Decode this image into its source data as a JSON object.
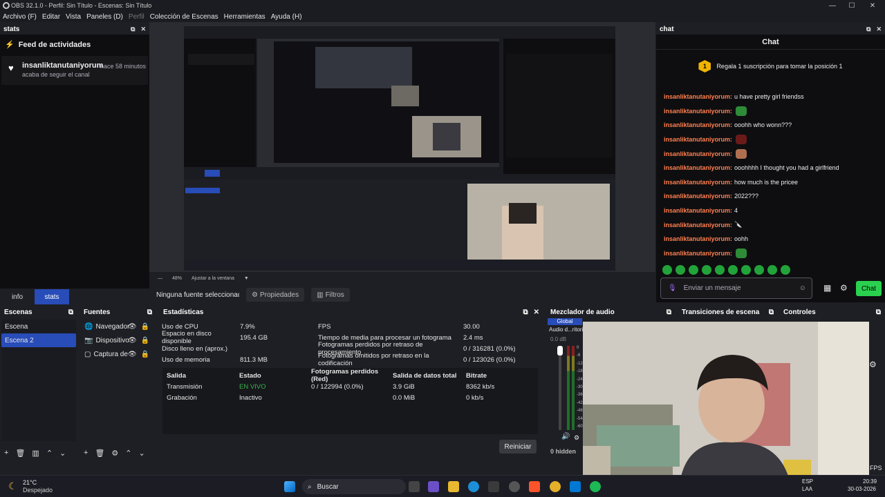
{
  "window": {
    "title": "OBS 32.1.0 - Perfil: Sin Título - Escenas: Sin Título",
    "min": "—",
    "max": "☐",
    "close": "✕"
  },
  "menu": [
    "Archivo (F)",
    "Editar",
    "Vista",
    "Paneles (D)",
    "Perfil",
    "Colección de Escenas",
    "Herramientas",
    "Ayuda (H)"
  ],
  "stats_dock": {
    "title": "stats",
    "feed_title": "Feed de actividades",
    "item": {
      "user": "insanliktanutaniyorum",
      "time": "hace 58 minutos",
      "action": "acaba de seguir el canal"
    }
  },
  "tabs": [
    {
      "label": "info"
    },
    {
      "label": "stats",
      "active": true
    }
  ],
  "zoom": {
    "value": "48%",
    "fit": "Ajustar a la ventana"
  },
  "source_bar": {
    "no_source": "Ninguna fuente seleccionada",
    "properties": "Propiedades",
    "filters": "Filtros"
  },
  "chat": {
    "dock_title": "chat",
    "header": "Chat",
    "sub_banner": "Regala 1 suscripción para tomar la posición 1",
    "badge_rank": "1",
    "messages": [
      {
        "user": "insanliktanutaniyorum:",
        "text": "u have pretty girl friendss",
        "emote": ""
      },
      {
        "user": "insanliktanutaniyorum:",
        "text": "",
        "emote": "green"
      },
      {
        "user": "insanliktanutaniyorum:",
        "text": "ooohh who wonn???",
        "emote": ""
      },
      {
        "user": "insanliktanutaniyorum:",
        "text": "",
        "emote": "dark"
      },
      {
        "user": "insanliktanutaniyorum:",
        "text": "",
        "emote": "skin"
      },
      {
        "user": "insanliktanutaniyorum:",
        "text": "ooohhhh I thought you had a girlfriend",
        "emote": ""
      },
      {
        "user": "insanliktanutaniyorum:",
        "text": "how much is the pricee",
        "emote": ""
      },
      {
        "user": "insanliktanutaniyorum:",
        "text": "2022???",
        "emote": ""
      },
      {
        "user": "insanliktanutaniyorum:",
        "text": "4",
        "emote": ""
      },
      {
        "user": "insanliktanutaniyorum:",
        "text": "🔪",
        "emote": ""
      },
      {
        "user": "insanliktanutaniyorum:",
        "text": "oohh",
        "emote": ""
      },
      {
        "user": "insanliktanutaniyorum:",
        "text": "",
        "emote": "green"
      }
    ],
    "input_placeholder": "Enviar un mensaje",
    "send": "Chat"
  },
  "scenes": {
    "title": "Escenas",
    "items": [
      {
        "label": "Escena"
      },
      {
        "label": "Escena 2",
        "selected": true
      }
    ]
  },
  "sources": {
    "title": "Fuentes",
    "items": [
      {
        "label": "Navegador",
        "icon": "globe-icon"
      },
      {
        "label": "Dispositivo de captura",
        "icon": "camera-icon"
      },
      {
        "label": "Captura de pantalla",
        "icon": "monitor-icon"
      }
    ]
  },
  "stats": {
    "title": "Estadísticas",
    "left": [
      [
        "Uso de CPU",
        "7.9%"
      ],
      [
        "Espacio en disco disponible",
        "195.4 GB"
      ],
      [
        "Disco lleno en (aprox.)",
        ""
      ],
      [
        "Uso de memoria",
        "811.3 MB"
      ]
    ],
    "right": [
      [
        "FPS",
        "30.00"
      ],
      [
        "Tiempo de media para procesar un fotograma",
        "2.4 ms"
      ],
      [
        "Fotogramas perdidos por retraso de procesamiento",
        "0 / 316281 (0.0%)"
      ],
      [
        "Fotogramas omitidos por retraso en la codificación",
        "0 / 123026 (0.0%)"
      ]
    ],
    "table_header": [
      "Salida",
      "Estado",
      "Fotogramas perdidos (Red)",
      "Salida de datos total",
      "Bitrate"
    ],
    "table_rows": [
      [
        "Transmisión",
        "EN VIVO",
        "0 / 122994 (0.0%)",
        "3.9 GiB",
        "8362 kb/s"
      ],
      [
        "Grabación",
        "Inactivo",
        "",
        "0.0 MiB",
        "0 kb/s"
      ]
    ],
    "live_color": "#39b54a",
    "reset": "Reiniciar"
  },
  "mixer": {
    "title": "Mezclador de audio",
    "tab": "Global",
    "track": "Audio d...ritorio",
    "db": "0.0 dB",
    "hidden": "0 hidden",
    "scale": [
      "0",
      "-6",
      "-12",
      "-18",
      "-24",
      "-30",
      "-36",
      "-42",
      "-48",
      "-54",
      "-60"
    ]
  },
  "transitions": {
    "title": "Transiciones de escena"
  },
  "controls": {
    "title": "Controles"
  },
  "fps_label": "FPS",
  "taskbar": {
    "temp": "21°C",
    "weather": "Despejado",
    "search": "Buscar",
    "lang": "ESP",
    "layout": "LAA",
    "time": "20:39",
    "date": "30-03-2026"
  }
}
